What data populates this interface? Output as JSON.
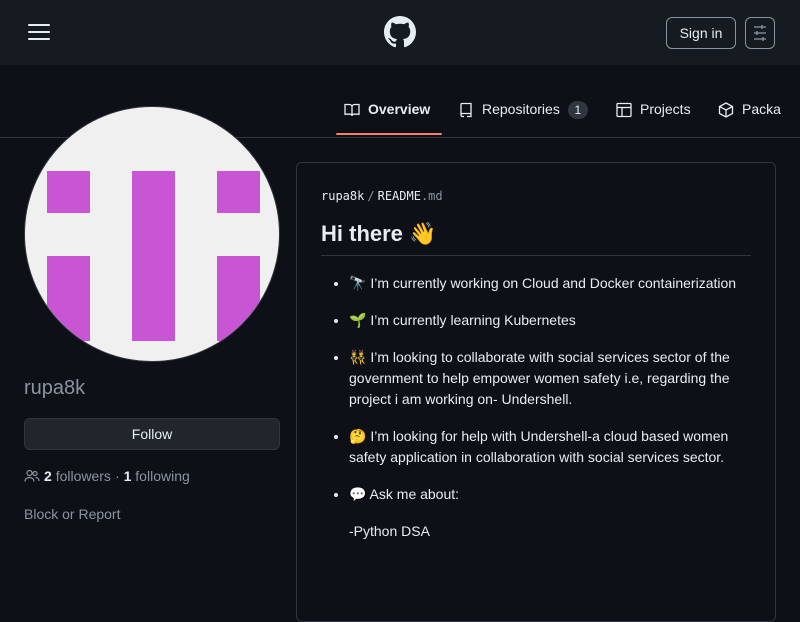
{
  "header": {
    "signin_label": "Sign in"
  },
  "tabs": [
    {
      "label": "Overview",
      "icon": "book-icon"
    },
    {
      "label": "Repositories",
      "icon": "repo-icon",
      "count": "1"
    },
    {
      "label": "Projects",
      "icon": "table-icon"
    },
    {
      "label": "Packa",
      "icon": "package-icon"
    }
  ],
  "profile": {
    "username": "rupa8k",
    "follow_label": "Follow",
    "followers_count": "2",
    "followers_label": "followers",
    "dot": "·",
    "following_count": "1",
    "following_label": "following",
    "block_report": "Block or Report"
  },
  "readme": {
    "owner": "rupa8k",
    "separator": "/",
    "file": "README",
    "ext": ".md",
    "title": "Hi there 👋",
    "items": [
      "🔭 I’m currently working on Cloud and Docker containerization",
      "🌱 I’m currently learning Kubernetes",
      "👯 I’m looking to collaborate with social services sector of the government to help empower women safety i.e, regarding the project i am working on- Undershell.",
      "🤔 I’m looking for help with Undershell-a cloud based women safety application in collaboration with social services sector.",
      "💬 Ask me about:"
    ],
    "sub_item": "-Python DSA"
  },
  "colors": {
    "bg": "#0d1117",
    "header_bg": "#161b22",
    "accent_underline": "#f78166",
    "avatar_magenta": "#c755d4"
  }
}
